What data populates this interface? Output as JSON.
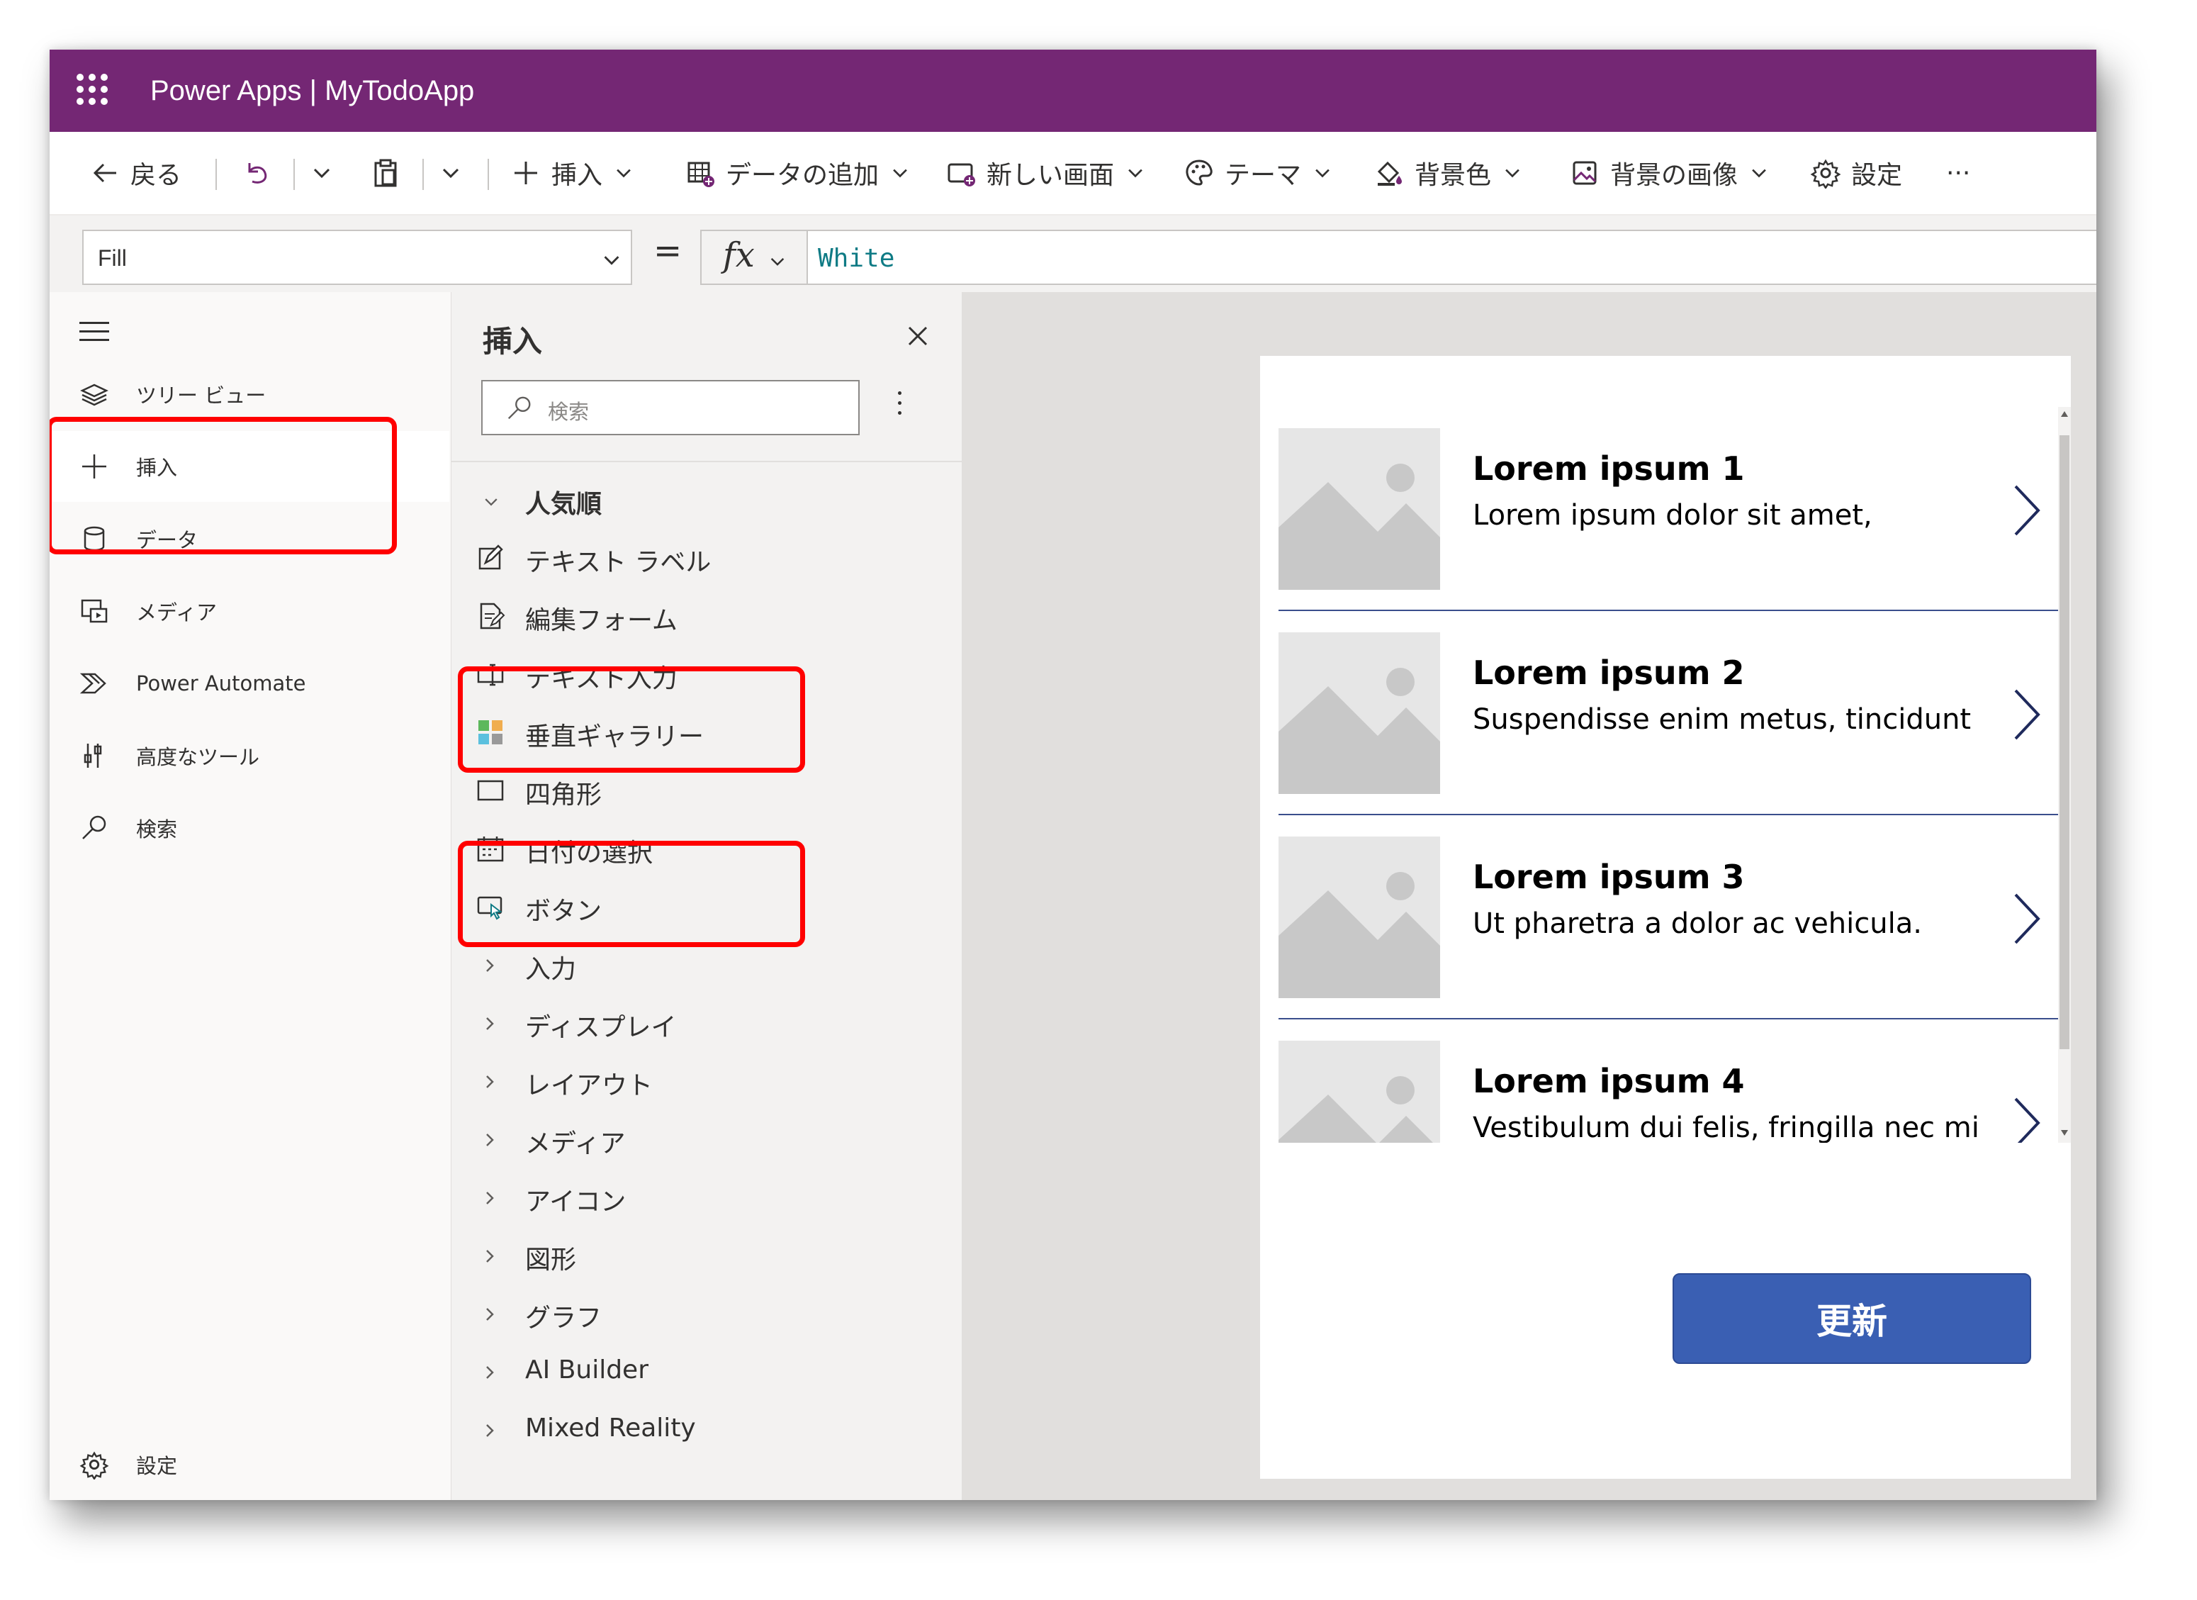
{
  "app": {
    "title": "Power Apps  |  MyTodoApp"
  },
  "command_bar": {
    "back": "戻る",
    "insert": "挿入",
    "add_data": "データの追加",
    "new_screen": "新しい画面",
    "theme": "テーマ",
    "background_color": "背景色",
    "background_image": "背景の画像",
    "settings": "設定",
    "more": "···"
  },
  "formula_bar": {
    "property": "Fill",
    "equals": "=",
    "fx": "fx",
    "formula": "White"
  },
  "left_rail": {
    "items": [
      {
        "label": "ツリー ビュー",
        "icon": "layers-icon"
      },
      {
        "label": "挿入",
        "icon": "plus-icon",
        "selected": true
      },
      {
        "label": "データ",
        "icon": "database-icon"
      },
      {
        "label": "メディア",
        "icon": "media-icon"
      },
      {
        "label": "Power Automate",
        "icon": "power-automate-icon"
      },
      {
        "label": "高度なツール",
        "icon": "tools-icon"
      },
      {
        "label": "検索",
        "icon": "search-icon"
      }
    ],
    "settings": "設定"
  },
  "insert_pane": {
    "title": "挿入",
    "search_placeholder": "検索",
    "popular_header": "人気順",
    "popular_items": [
      {
        "label": "テキスト ラベル",
        "icon": "edit-icon"
      },
      {
        "label": "編集フォーム",
        "icon": "form-icon"
      },
      {
        "label": "テキスト入力",
        "icon": "text-input-icon"
      },
      {
        "label": "垂直ギャラリー",
        "icon": "gallery-icon"
      },
      {
        "label": "四角形",
        "icon": "rectangle-icon"
      },
      {
        "label": "日付の選択",
        "icon": "calendar-icon"
      },
      {
        "label": "ボタン",
        "icon": "button-icon"
      }
    ],
    "categories": [
      "入力",
      "ディスプレイ",
      "レイアウト",
      "メディア",
      "アイコン",
      "図形",
      "グラフ",
      "AI Builder",
      "Mixed Reality"
    ]
  },
  "canvas": {
    "gallery_items": [
      {
        "title": "Lorem ipsum 1",
        "subtitle": "Lorem ipsum dolor sit amet,"
      },
      {
        "title": "Lorem ipsum 2",
        "subtitle": "Suspendisse enim metus, tincidunt"
      },
      {
        "title": "Lorem ipsum 3",
        "subtitle": "Ut pharetra a dolor ac vehicula."
      },
      {
        "title": "Lorem ipsum 4",
        "subtitle": "Vestibulum dui felis, fringilla nec mi"
      }
    ],
    "refresh_button": "更新"
  },
  "colors": {
    "title_bar": "#742774",
    "highlight": "#ff0000",
    "button": "#3a5fb3",
    "formula_text": "#0f7b85"
  }
}
